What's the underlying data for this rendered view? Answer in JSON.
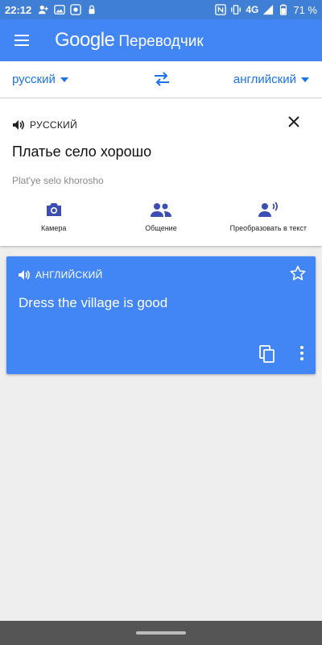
{
  "status_bar": {
    "time": "22:12",
    "network": "4G",
    "battery": "71 %",
    "left_icons": [
      "person-add-icon",
      "image-icon",
      "app-icon",
      "lock-icon"
    ],
    "right_icons": [
      "nfc-icon",
      "vibrate-icon",
      "4g-signal-icon",
      "signal-icon",
      "battery-icon"
    ]
  },
  "app_bar": {
    "brand": "Google",
    "product": "Переводчик",
    "menu_icon": "menu-icon"
  },
  "languages": {
    "source": "русский",
    "target": "английский",
    "swap_icon": "swap-arrows-icon"
  },
  "input": {
    "language_label": "РУССКИЙ",
    "text": "Платье село хорошо",
    "transliteration": "Plat'ye selo khorosho",
    "tools": [
      {
        "label": "Камера",
        "icon": "camera-icon"
      },
      {
        "label": "Общение",
        "icon": "conversation-icon"
      },
      {
        "label": "Преобразовать в текст",
        "icon": "transcribe-icon"
      }
    ]
  },
  "output": {
    "language_label": "АНГЛИЙСКИЙ",
    "text": "Dress the village is good"
  },
  "colors": {
    "brand_blue": "#4285f4",
    "status_blue": "#3f7fd6",
    "link_blue": "#1a73e8",
    "icon_indigo": "#3c4db3",
    "background": "#eeeeee"
  }
}
